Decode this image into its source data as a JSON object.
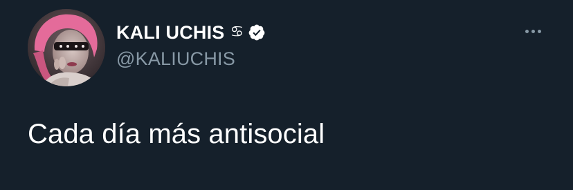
{
  "tweet": {
    "display_name": "KALI UCHIS",
    "name_emoji": "♋",
    "handle": "@KALIUCHIS",
    "text": "Cada día más antisocial",
    "verified": true,
    "avatar_icon": "profile-photo",
    "more_icon": "more-horizontal-icon"
  },
  "colors": {
    "background": "#15202b",
    "primary_text": "#ffffff",
    "secondary_text": "#8899a6",
    "verified_badge": "#ffffff"
  }
}
